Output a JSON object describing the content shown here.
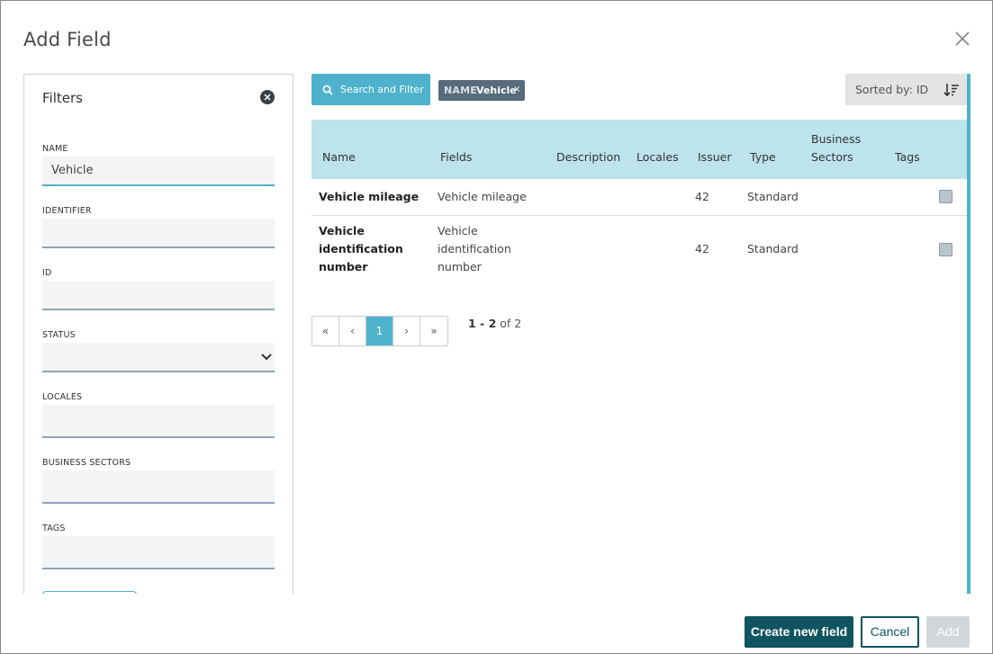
{
  "dialog": {
    "title": "Add Field"
  },
  "filters": {
    "title": "Filters",
    "name_label": "NAME",
    "name_value": "Vehicle",
    "identifier_label": "IDENTIFIER",
    "identifier_value": "",
    "id_label": "ID",
    "id_value": "",
    "status_label": "STATUS",
    "status_value": "",
    "locales_label": "LOCALES",
    "locales_value": "",
    "business_sectors_label": "BUSINESS SECTORS",
    "business_sectors_value": "",
    "tags_label": "TAGS",
    "tags_value": ""
  },
  "toolbar": {
    "search_label": "Search and Filter",
    "chip_key": "NAME",
    "chip_value": "Vehicle",
    "chip_remove": "×",
    "sort_label": "Sorted by: ID"
  },
  "table": {
    "columns": [
      "Name",
      "Fields",
      "Description",
      "Locales",
      "Issuer",
      "Type",
      "Business Sectors",
      "Tags"
    ],
    "rows": [
      {
        "name": "Vehicle mileage",
        "fields": "Vehicle mileage",
        "description": "",
        "locales": "",
        "issuer": "42",
        "type": "Standard",
        "business_sectors": "",
        "tags": ""
      },
      {
        "name": "Vehicle identification number",
        "fields": "Vehicle identification number",
        "description": "",
        "locales": "",
        "issuer": "42",
        "type": "Standard",
        "business_sectors": "",
        "tags": ""
      }
    ]
  },
  "pagination": {
    "first": "«",
    "prev": "‹",
    "current": "1",
    "next": "›",
    "last": "»",
    "range": "1 - 2",
    "of_label": "of 2"
  },
  "footer": {
    "create_label": "Create new field",
    "cancel_label": "Cancel",
    "add_label": "Add"
  },
  "colors": {
    "accent": "#4fb2cc",
    "primary_dark": "#0f5461",
    "table_header": "#bde3ec",
    "chip": "#576b7a"
  }
}
